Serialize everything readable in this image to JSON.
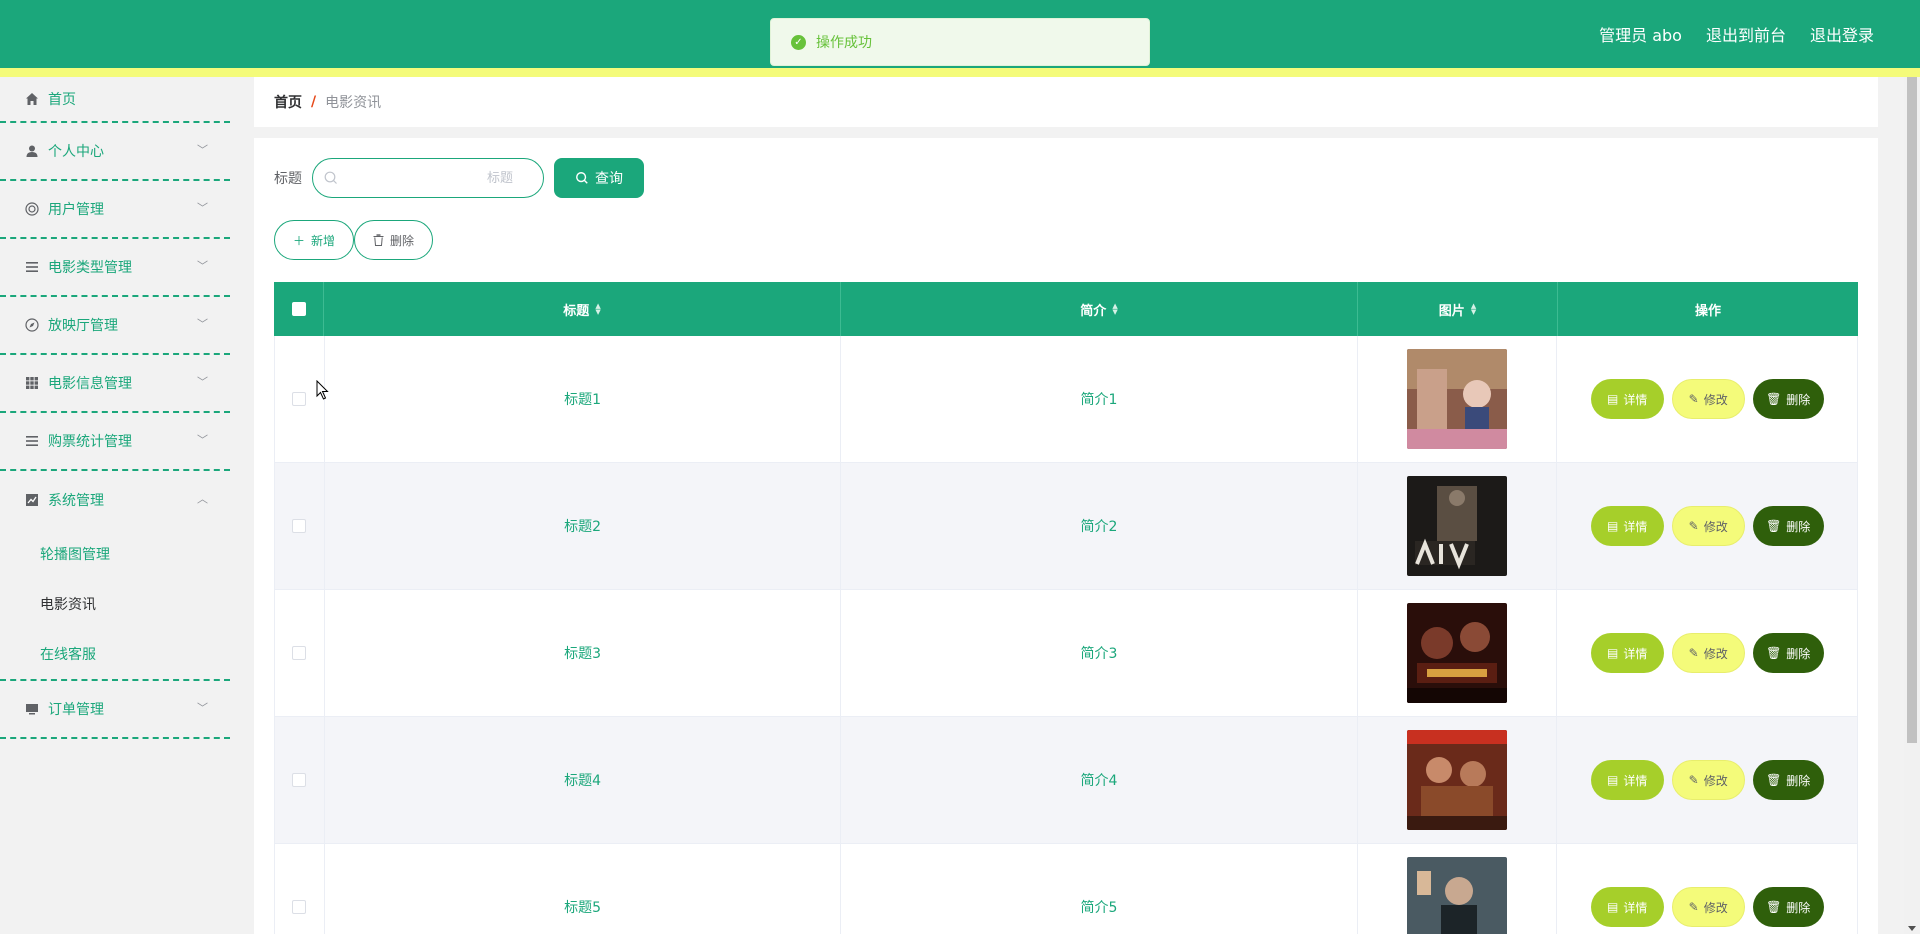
{
  "header": {
    "admin_label": "管理员 abo",
    "front_link": "退出到前台",
    "logout_link": "退出登录",
    "bg_color": "#1ba77b",
    "strip_color": "#f4fb7a"
  },
  "toast": {
    "message": "操作成功"
  },
  "sidebar": {
    "home": "首页",
    "menus": [
      {
        "label": "个人中心",
        "icon": "user-icon"
      },
      {
        "label": "用户管理",
        "icon": "life-ring-icon"
      },
      {
        "label": "电影类型管理",
        "icon": "list-icon"
      },
      {
        "label": "放映厅管理",
        "icon": "compass-icon"
      },
      {
        "label": "电影信息管理",
        "icon": "grid-icon"
      },
      {
        "label": "购票统计管理",
        "icon": "list-icon"
      },
      {
        "label": "系统管理",
        "icon": "chart-icon"
      }
    ],
    "submenu": [
      "轮播图管理",
      "电影资讯",
      "在线客服"
    ],
    "order_menu": {
      "label": "订单管理",
      "icon": "monitor-icon"
    }
  },
  "breadcrumb": {
    "home": "首页",
    "separator": "/",
    "current": "电影资讯"
  },
  "search": {
    "label": "标题",
    "placeholder": "标题",
    "value": "",
    "button": "查询"
  },
  "actions": {
    "add": "新增",
    "delete": "删除"
  },
  "table": {
    "columns": {
      "title": "标题",
      "intro": "简介",
      "image": "图片",
      "ops": "操作"
    },
    "rows": [
      {
        "title": "标题1",
        "intro": "简介1"
      },
      {
        "title": "标题2",
        "intro": "简介2"
      },
      {
        "title": "标题3",
        "intro": "简介3"
      },
      {
        "title": "标题4",
        "intro": "简介4"
      },
      {
        "title": "标题5",
        "intro": "简介5"
      }
    ],
    "op_labels": {
      "detail": "详情",
      "edit": "修改",
      "remove": "删除"
    }
  }
}
